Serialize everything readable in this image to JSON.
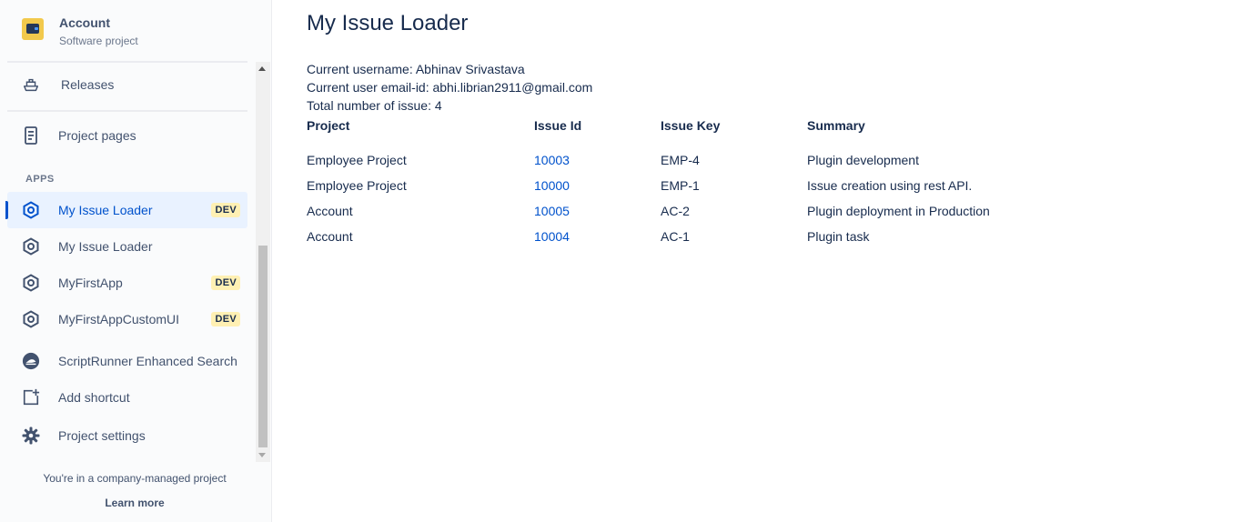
{
  "sidebar": {
    "project": {
      "name": "Account",
      "type": "Software project",
      "avatar_icon": "wallet-icon",
      "avatar_color": "#f2c94c"
    },
    "items": [
      {
        "label": "Releases",
        "icon": "ship-icon"
      },
      {
        "label": "Project pages",
        "icon": "document-icon"
      }
    ],
    "apps_heading": "APPS",
    "apps": [
      {
        "label": "My Issue Loader",
        "icon": "forge-app-icon",
        "badge": "DEV",
        "active": true
      },
      {
        "label": "My Issue Loader",
        "icon": "forge-app-icon",
        "badge": ""
      },
      {
        "label": "MyFirstApp",
        "icon": "forge-app-icon",
        "badge": "DEV"
      },
      {
        "label": "MyFirstAppCustomUI",
        "icon": "forge-app-icon",
        "badge": "DEV"
      },
      {
        "label": "ScriptRunner Enhanced Search",
        "icon": "scriptrunner-icon",
        "badge": ""
      }
    ],
    "add_shortcut": {
      "label": "Add shortcut",
      "icon": "add-shortcut-icon"
    },
    "project_settings": {
      "label": "Project settings",
      "icon": "gear-icon"
    },
    "footer": {
      "text": "You're in a company-managed project",
      "link": "Learn more"
    }
  },
  "main": {
    "title": "My Issue Loader",
    "username_line": "Current username: Abhinav Srivastava",
    "email_line": "Current user email-id: abhi.librian2911@gmail.com",
    "total_line": "Total number of issue: 4",
    "table": {
      "headers": [
        "Project",
        "Issue Id",
        "Issue Key",
        "Summary"
      ],
      "rows": [
        {
          "project": "Employee Project",
          "id": "10003",
          "key": "EMP-4",
          "summary": "Plugin development"
        },
        {
          "project": "Employee Project",
          "id": "10000",
          "key": "EMP-1",
          "summary": "Issue creation using rest API."
        },
        {
          "project": "Account",
          "id": "10005",
          "key": "AC-2",
          "summary": "Plugin deployment in Production"
        },
        {
          "project": "Account",
          "id": "10004",
          "key": "AC-1",
          "summary": "Plugin task"
        }
      ]
    }
  },
  "colors": {
    "accent": "#0052cc",
    "active_bg": "#e9f2ff",
    "badge_bg": "#fff0b3",
    "text": "#172b4d"
  }
}
